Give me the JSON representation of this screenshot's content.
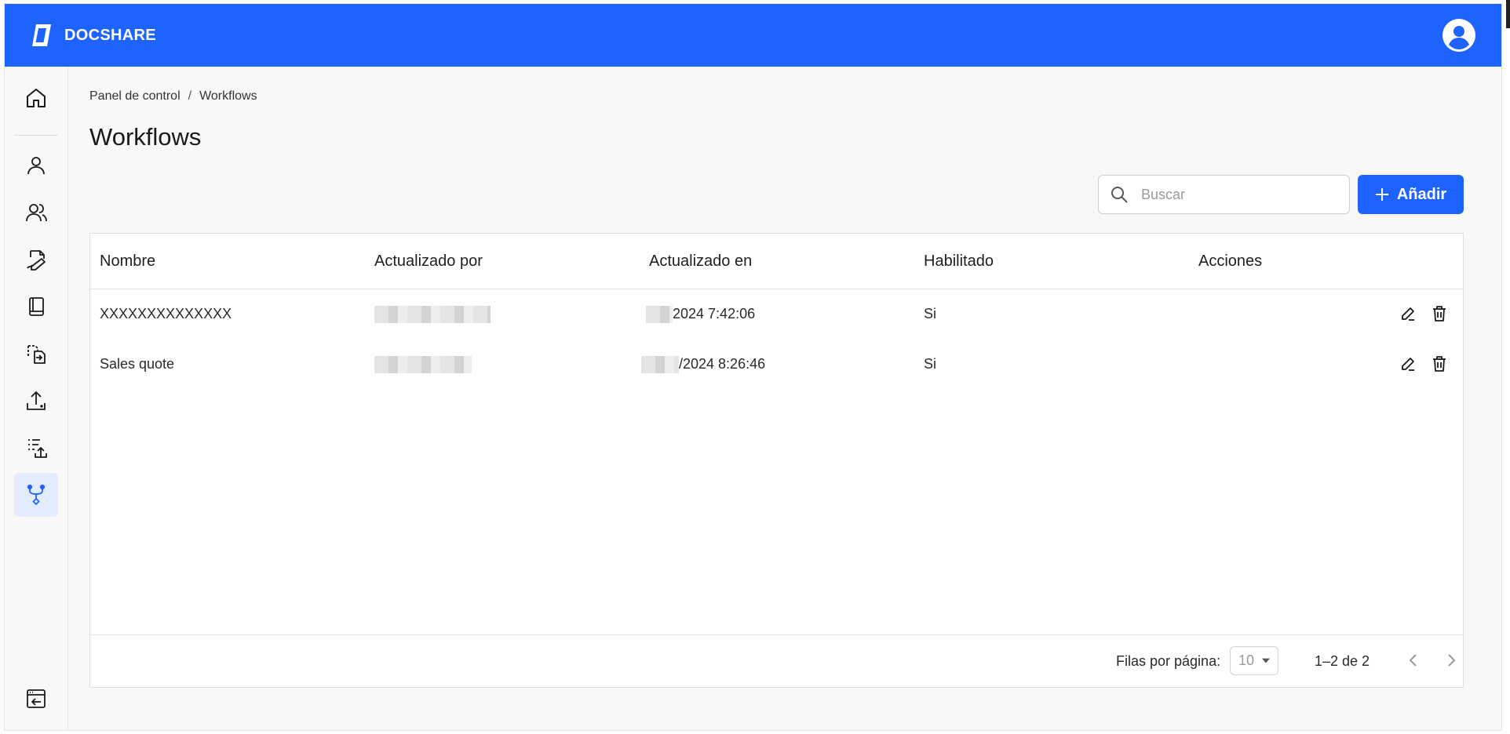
{
  "app": {
    "brand": "DOCSHARE",
    "colors": {
      "primary": "#1f63ff",
      "active_bg": "#e3ecff"
    }
  },
  "sidebar": {
    "items": [
      {
        "icon": "home-icon"
      },
      {
        "icon": "user-icon"
      },
      {
        "icon": "users-icon"
      },
      {
        "icon": "document-sign-icon"
      },
      {
        "icon": "book-icon"
      },
      {
        "icon": "document-transfer-icon"
      },
      {
        "icon": "upload-icon"
      },
      {
        "icon": "list-upload-icon"
      },
      {
        "icon": "workflow-icon",
        "active": true
      },
      {
        "icon": "logout-icon"
      }
    ]
  },
  "breadcrumb": {
    "parent": "Panel de control",
    "separator": "/",
    "current": "Workflows"
  },
  "page": {
    "title": "Workflows"
  },
  "search": {
    "placeholder": "Buscar"
  },
  "add_button": {
    "label": "Añadir"
  },
  "table": {
    "columns": [
      "Nombre",
      "Actualizado por",
      "Actualizado en",
      "Habilitado",
      "Acciones"
    ],
    "rows": [
      {
        "name": "XXXXXXXXXXXXXX",
        "updated_by": "",
        "updated_at": "2024 7:42:06",
        "enabled": "Si"
      },
      {
        "name": "Sales quote",
        "updated_by": "",
        "updated_at": "/2024 8:26:46",
        "enabled": "Si"
      }
    ]
  },
  "pagination": {
    "rows_label": "Filas por página:",
    "rows_value": "10",
    "range": "1–2 de 2"
  }
}
